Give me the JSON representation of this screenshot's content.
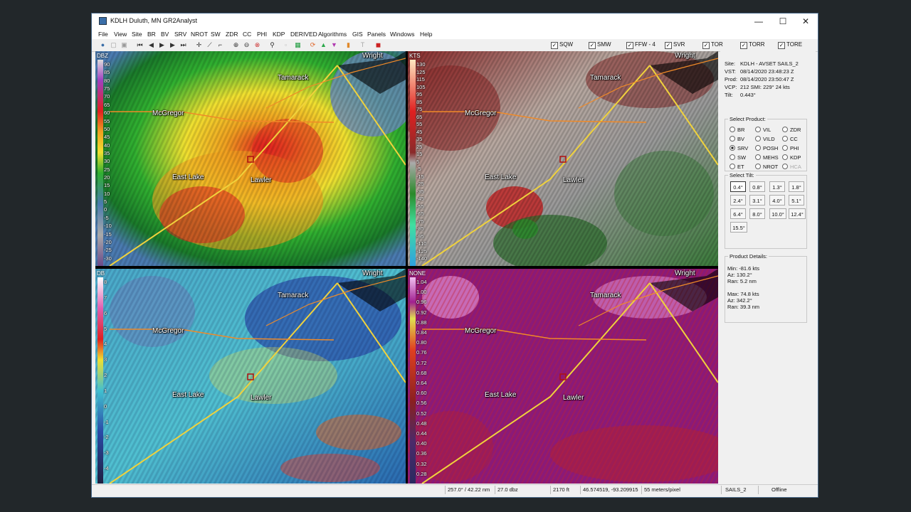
{
  "window": {
    "title": "KDLH Duluth, MN   GR2Analyst",
    "minimize": "—",
    "maximize": "☐",
    "close": "✕"
  },
  "menu": [
    "File",
    "View",
    "Site",
    "BR",
    "BV",
    "SRV",
    "NROT",
    "SW",
    "ZDR",
    "CC",
    "PHI",
    "KDP",
    "DERIVED",
    "Algorithms",
    "GIS",
    "Panels",
    "Windows",
    "Help"
  ],
  "toolbar": {
    "icons": [
      "globe-icon",
      "copy-icon",
      "paste-icon",
      "print-icon",
      "skip-start-icon",
      "step-back-icon",
      "play-icon",
      "step-forward-icon",
      "skip-end-icon",
      "crosshair-icon",
      "measure-icon",
      "probe-icon",
      "zoom-in-icon",
      "zoom-out-icon",
      "zoom-reset-icon",
      "eyedrop-icon",
      "blank-icon",
      "grid-icon",
      "refresh-icon",
      "triangle-up-icon",
      "triangle-down-icon",
      "layers-icon",
      "text-icon",
      "stop-icon"
    ],
    "checks": [
      "SQW",
      "SMW",
      "FFW - 4",
      "SVR",
      "TOR",
      "TORR",
      "TORE"
    ]
  },
  "panes": [
    {
      "unit": "DBZ",
      "ticks": [
        "90",
        "85",
        "80",
        "75",
        "70",
        "65",
        "60",
        "55",
        "50",
        "45",
        "40",
        "35",
        "30",
        "25",
        "20",
        "15",
        "10",
        "5",
        "0",
        "-5",
        "-10",
        "-15",
        "-20",
        "-25",
        "-30"
      ]
    },
    {
      "unit": "KTS",
      "ticks": [
        "130",
        "125",
        "115",
        "105",
        "95",
        "85",
        "75",
        "65",
        "55",
        "45",
        "35",
        "25",
        "15",
        "5",
        "-5",
        "-15",
        "-25",
        "-35",
        "-45",
        "-55",
        "-65",
        "-75",
        "-85",
        "-95",
        "-110",
        "-125",
        "-140"
      ]
    },
    {
      "unit": "DB",
      "ticks": [
        "8",
        "7",
        "6",
        "5",
        "4",
        "3",
        "2",
        "1",
        "0",
        "-1",
        "-2",
        "-3",
        "-4"
      ]
    },
    {
      "unit": "NONE",
      "ticks": [
        "1.04",
        "1.00",
        "0.96",
        "0.92",
        "0.88",
        "0.84",
        "0.80",
        "0.76",
        "0.72",
        "0.68",
        "0.64",
        "0.60",
        "0.56",
        "0.52",
        "0.48",
        "0.44",
        "0.40",
        "0.36",
        "0.32",
        "0.28"
      ]
    }
  ],
  "cities": [
    "Wright",
    "Tamarack",
    "McGregor",
    "East Lake",
    "Lawler"
  ],
  "colors": {
    "accent": "#3a6ea8",
    "road_primary": "#f0d23c",
    "road_secondary": "#f08a28"
  },
  "info": [
    {
      "k": "Site:",
      "v": "KDLH - AVSET SAILS_2"
    },
    {
      "k": "VST:",
      "v": "08/14/2020  23:48:23 Z"
    },
    {
      "k": "Prod:",
      "v": "08/14/2020  23:50:47 Z"
    },
    {
      "k": "VCP:",
      "v": "212          SMI:  229° 24 kts"
    },
    {
      "k": "Tilt:",
      "v": "0.443°"
    }
  ],
  "select_product": {
    "label": "Select Product:",
    "items": [
      {
        "name": "BR",
        "sel": false,
        "dis": false
      },
      {
        "name": "VIL",
        "sel": false,
        "dis": false
      },
      {
        "name": "ZDR",
        "sel": false,
        "dis": false
      },
      {
        "name": "BV",
        "sel": false,
        "dis": false
      },
      {
        "name": "VILD",
        "sel": false,
        "dis": false
      },
      {
        "name": "CC",
        "sel": false,
        "dis": false
      },
      {
        "name": "SRV",
        "sel": true,
        "dis": false
      },
      {
        "name": "POSH",
        "sel": false,
        "dis": false
      },
      {
        "name": "PHI",
        "sel": false,
        "dis": false
      },
      {
        "name": "SW",
        "sel": false,
        "dis": false
      },
      {
        "name": "MEHS",
        "sel": false,
        "dis": false
      },
      {
        "name": "KDP",
        "sel": false,
        "dis": false
      },
      {
        "name": "ET",
        "sel": false,
        "dis": false
      },
      {
        "name": "NROT",
        "sel": false,
        "dis": false
      },
      {
        "name": "HCA",
        "sel": false,
        "dis": true
      }
    ]
  },
  "select_tilt": {
    "label": "Select Tilt:",
    "items": [
      "0.4°",
      "0.8°",
      "1.3°",
      "1.8°",
      "2.4°",
      "3.1°",
      "4.0°",
      "5.1°",
      "6.4°",
      "8.0°",
      "10.0°",
      "12.4°",
      "15.5°"
    ],
    "selected": 0
  },
  "product_details": {
    "label": "Product Details:",
    "lines": [
      "Min:  -81.6 kts",
      "Az:   130.2°",
      "Ran:  5.2 nm",
      "",
      "Max:  74.8 kts",
      "Az:   342.2°",
      "Ran:  39.3 nm"
    ]
  },
  "status": [
    "257.0° / 42.22 nm",
    "27.0 dbz",
    "2170 ft",
    "46.574519, -93.209915",
    "55 meters/pixel",
    "SAILS_2",
    "Offline"
  ]
}
